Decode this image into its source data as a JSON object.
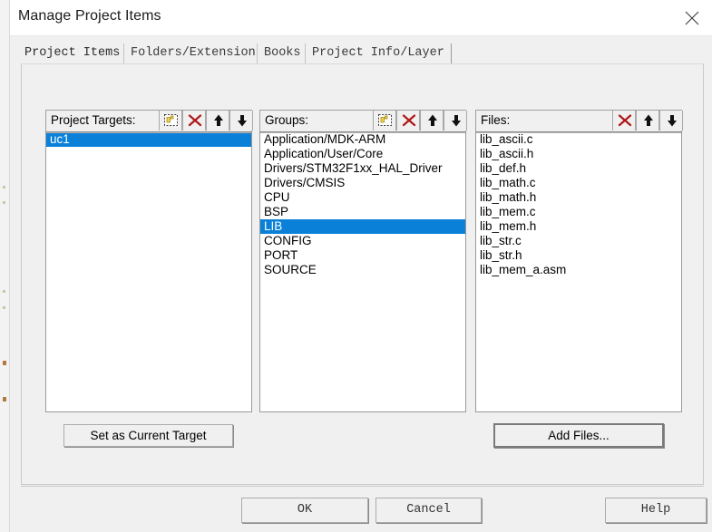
{
  "window": {
    "title": "Manage Project Items",
    "close_icon": "close-icon"
  },
  "tabs": [
    {
      "label": "Project Items",
      "active": true
    },
    {
      "label": "Folders/Extensions",
      "active": false
    },
    {
      "label": "Books",
      "active": false
    },
    {
      "label": "Project Info/Layer",
      "active": false
    }
  ],
  "colors": {
    "selection": "#0a80d8",
    "selection_text": "#ffffff",
    "dialog_face": "#f0f0f0",
    "delete_icon": "#b01818",
    "new_icon_accent": "#f5d24a"
  },
  "columns": [
    {
      "id": "project-targets",
      "label": "Project Targets:",
      "tools": [
        {
          "name": "new-item-icon",
          "title": "New (Insert)"
        },
        {
          "name": "delete-item-icon",
          "title": "Delete"
        },
        {
          "name": "move-up-icon",
          "title": "Move Up"
        },
        {
          "name": "move-down-icon",
          "title": "Move Down"
        }
      ],
      "items": [
        {
          "label": "uc1",
          "selected": true
        }
      ]
    },
    {
      "id": "groups",
      "label": "Groups:",
      "tools": [
        {
          "name": "new-item-icon",
          "title": "New (Insert)"
        },
        {
          "name": "delete-item-icon",
          "title": "Delete"
        },
        {
          "name": "move-up-icon",
          "title": "Move Up"
        },
        {
          "name": "move-down-icon",
          "title": "Move Down"
        }
      ],
      "items": [
        {
          "label": "Application/MDK-ARM",
          "selected": false
        },
        {
          "label": "Application/User/Core",
          "selected": false
        },
        {
          "label": "Drivers/STM32F1xx_HAL_Driver",
          "selected": false
        },
        {
          "label": "Drivers/CMSIS",
          "selected": false
        },
        {
          "label": "CPU",
          "selected": false
        },
        {
          "label": "BSP",
          "selected": false
        },
        {
          "label": "LIB",
          "selected": true
        },
        {
          "label": "CONFIG",
          "selected": false
        },
        {
          "label": "PORT",
          "selected": false
        },
        {
          "label": "SOURCE",
          "selected": false
        }
      ]
    },
    {
      "id": "files",
      "label": "Files:",
      "tools": [
        {
          "name": "delete-item-icon",
          "title": "Delete"
        },
        {
          "name": "move-up-icon",
          "title": "Move Up"
        },
        {
          "name": "move-down-icon",
          "title": "Move Down"
        }
      ],
      "items": [
        {
          "label": "lib_ascii.c",
          "selected": false
        },
        {
          "label": "lib_ascii.h",
          "selected": false
        },
        {
          "label": "lib_def.h",
          "selected": false
        },
        {
          "label": "lib_math.c",
          "selected": false
        },
        {
          "label": "lib_math.h",
          "selected": false
        },
        {
          "label": "lib_mem.c",
          "selected": false
        },
        {
          "label": "lib_mem.h",
          "selected": false
        },
        {
          "label": "lib_str.c",
          "selected": false
        },
        {
          "label": "lib_str.h",
          "selected": false
        },
        {
          "label": "lib_mem_a.asm",
          "selected": false
        }
      ]
    }
  ],
  "panel_buttons": {
    "set_as_current_target": "Set as Current Target",
    "add_files": "Add Files..."
  },
  "dialog_buttons": {
    "ok": "OK",
    "cancel": "Cancel",
    "help": "Help"
  }
}
